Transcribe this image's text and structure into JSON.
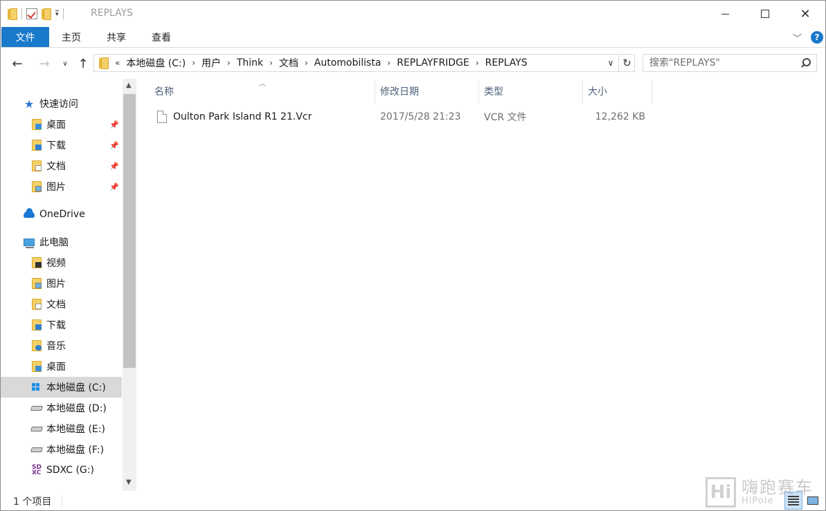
{
  "window": {
    "title": "REPLAYS",
    "minimize_glyph": "—",
    "close_glyph": "✕"
  },
  "ribbon": {
    "file_tab": "文件",
    "tabs": [
      "主页",
      "共享",
      "查看"
    ],
    "help_glyph": "?",
    "expand_glyph": "﹀"
  },
  "address": {
    "lead": "«",
    "crumbs": [
      "本地磁盘 (C:)",
      "用户",
      "Think",
      "文档",
      "Automobilista",
      "REPLAYFRIDGE",
      "REPLAYS"
    ],
    "separator": "›"
  },
  "search": {
    "placeholder": "搜索\"REPLAYS\""
  },
  "navpane": {
    "quick_access": "快速访问",
    "quick_items": [
      "桌面",
      "下载",
      "文档",
      "图片"
    ],
    "onedrive": "OneDrive",
    "this_pc": "此电脑",
    "pc_items": [
      "视频",
      "图片",
      "文档",
      "下载",
      "音乐",
      "桌面"
    ],
    "drives": [
      "本地磁盘 (C:)",
      "本地磁盘 (D:)",
      "本地磁盘 (E:)",
      "本地磁盘 (F:)",
      "SDXC (G:)"
    ],
    "selected_drive": "本地磁盘 (C:)"
  },
  "columns": {
    "name": "名称",
    "modified": "修改日期",
    "type": "类型",
    "size": "大小"
  },
  "files": [
    {
      "name": "Oulton Park Island R1 21.Vcr",
      "modified": "2017/5/28 21:23",
      "type": "VCR 文件",
      "size": "12,262 KB"
    }
  ],
  "status": {
    "item_count": "1 个项目"
  },
  "watermark": {
    "logo": "Hi",
    "cn": "嗨跑赛车",
    "en": "HiPole"
  },
  "colors": {
    "file_tab_bg": "#1979ca",
    "selected_nav_bg": "#d9d9d9",
    "column_header_text": "#4c607a"
  }
}
